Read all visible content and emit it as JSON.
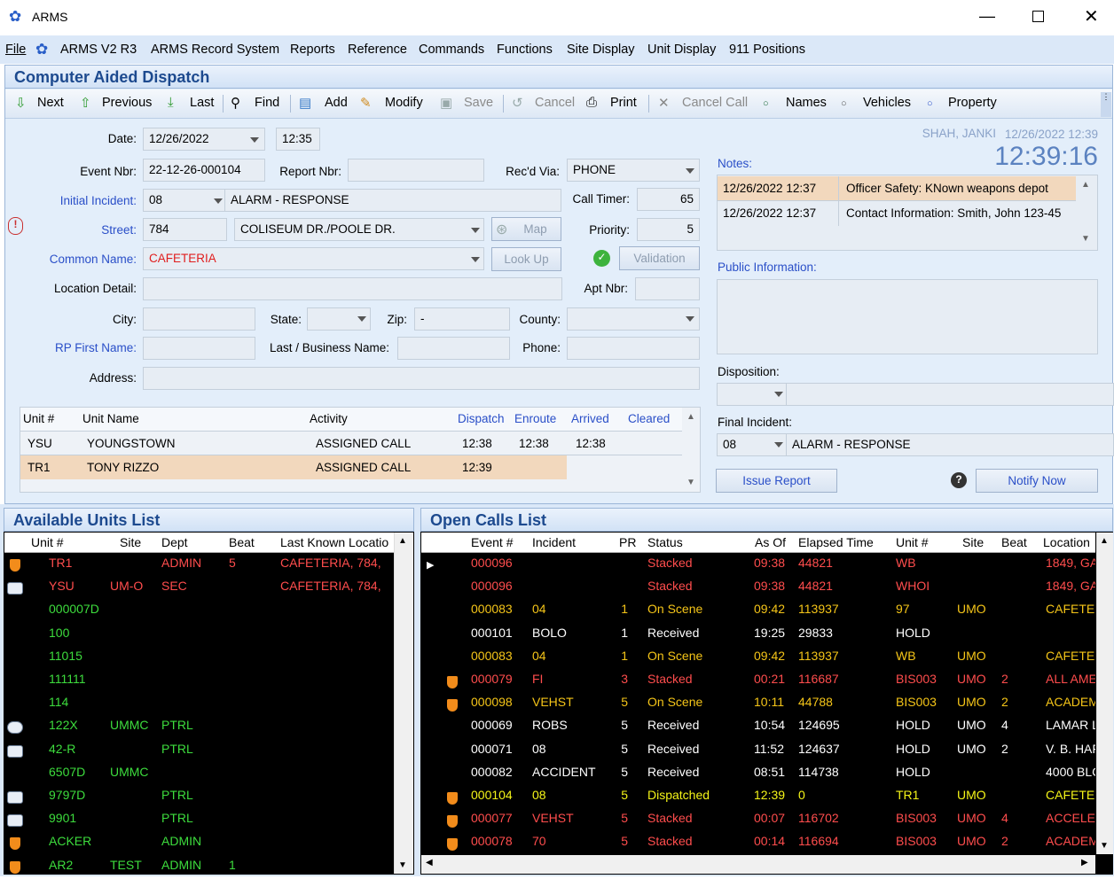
{
  "window": {
    "title": "ARMS"
  },
  "menu": [
    "File",
    "ARMS V2 R3",
    "ARMS Record System",
    "Reports",
    "Reference",
    "Commands",
    "Functions",
    "Site Display",
    "Unit Display",
    "911 Positions"
  ],
  "cad": {
    "title": "Computer Aided Dispatch",
    "toolbar": {
      "next": "Next",
      "previous": "Previous",
      "last": "Last",
      "find": "Find",
      "add": "Add",
      "modify": "Modify",
      "save": "Save",
      "cancel": "Cancel",
      "print": "Print",
      "cancel_call": "Cancel Call",
      "names": "Names",
      "vehicles": "Vehicles",
      "property": "Property"
    },
    "labels": {
      "date": "Date:",
      "event_nbr": "Event Nbr:",
      "report_nbr": "Report Nbr:",
      "recd_via": "Rec'd Via:",
      "initial_incident": "Initial Incident:",
      "call_timer": "Call Timer:",
      "street": "Street:",
      "priority": "Priority:",
      "common_name": "Common Name:",
      "location_detail": "Location Detail:",
      "apt_nbr": "Apt Nbr:",
      "city": "City:",
      "state": "State:",
      "zip": "Zip:",
      "county": "County:",
      "rp_first_name": "RP First Name:",
      "last_business_name": "Last / Business Name:",
      "phone": "Phone:",
      "address": "Address:"
    },
    "values": {
      "date": "12/26/2022",
      "time": "12:35",
      "event_nbr": "22-12-26-000104",
      "recd_via": "PHONE",
      "incident_code": "08",
      "incident_desc": "ALARM - RESPONSE",
      "call_timer": "65",
      "street_number": "784",
      "street_name": "COLISEUM DR./POOLE DR.",
      "priority": "5",
      "common_name": "CAFETERIA",
      "zip": "-"
    },
    "buttons": {
      "map": "Map",
      "look_up": "Look Up",
      "validation": "Validation",
      "issue_report": "Issue Report",
      "notify_now": "Notify Now"
    },
    "user": {
      "name": "SHAH, JANKI",
      "timestamp": "12/26/2022 12:39",
      "clock": "12:39:16"
    },
    "notes": {
      "label": "Notes:",
      "rows": [
        [
          "12/26/2022 12:37",
          "Officer Safety: KNown weapons depot"
        ],
        [
          "12/26/2022 12:37",
          "Contact Information: Smith, John 123-45"
        ]
      ]
    },
    "public_info_label": "Public Information:",
    "disposition_label": "Disposition:",
    "final_incident": {
      "label": "Final Incident:",
      "code": "08",
      "desc": "ALARM - RESPONSE"
    },
    "units": {
      "headers": [
        "Unit #",
        "Unit Name",
        "Activity",
        "Dispatch",
        "Enroute",
        "Arrived",
        "Cleared"
      ],
      "rows": [
        [
          "YSU",
          "YOUNGSTOWN",
          "ASSIGNED CALL",
          "12:38",
          "12:38",
          "12:38",
          ""
        ],
        [
          "TR1",
          "TONY RIZZO",
          "ASSIGNED CALL",
          "12:39",
          "",
          "",
          ""
        ]
      ]
    }
  },
  "available": {
    "title": "Available Units List",
    "headers": [
      "Unit #",
      "Site",
      "Dept",
      "Beat",
      "Last Known Locatio"
    ],
    "rows": [
      {
        "icon": "shield",
        "c": [
          "TR1",
          "",
          "ADMIN",
          "5",
          "CAFETERIA, 784,"
        ],
        "color": "#ff4d4d"
      },
      {
        "icon": "car",
        "c": [
          "YSU",
          "UM-O",
          "SEC",
          "",
          "CAFETERIA, 784,"
        ],
        "color": "#ff4d4d"
      },
      {
        "icon": "",
        "c": [
          "000007D",
          "",
          "",
          "",
          ""
        ],
        "color": "#3ddc3d"
      },
      {
        "icon": "",
        "c": [
          "100",
          "",
          "",
          "",
          ""
        ],
        "color": "#3ddc3d"
      },
      {
        "icon": "",
        "c": [
          "11015",
          "",
          "",
          "",
          ""
        ],
        "color": "#3ddc3d"
      },
      {
        "icon": "",
        "c": [
          "111111",
          "",
          "",
          "",
          ""
        ],
        "color": "#3ddc3d"
      },
      {
        "icon": "",
        "c": [
          "114",
          "",
          "",
          "",
          ""
        ],
        "color": "#3ddc3d"
      },
      {
        "icon": "bike",
        "c": [
          "122X",
          "UMMC",
          "PTRL",
          "",
          ""
        ],
        "color": "#3ddc3d"
      },
      {
        "icon": "car",
        "c": [
          "42-R",
          "",
          "PTRL",
          "",
          ""
        ],
        "color": "#3ddc3d"
      },
      {
        "icon": "",
        "c": [
          "6507D",
          "UMMC",
          "",
          "",
          ""
        ],
        "color": "#3ddc3d"
      },
      {
        "icon": "car",
        "c": [
          "9797D",
          "",
          "PTRL",
          "",
          ""
        ],
        "color": "#3ddc3d"
      },
      {
        "icon": "car",
        "c": [
          "9901",
          "",
          "PTRL",
          "",
          ""
        ],
        "color": "#3ddc3d"
      },
      {
        "icon": "shield",
        "c": [
          "ACKER",
          "",
          "ADMIN",
          "",
          ""
        ],
        "color": "#3ddc3d"
      },
      {
        "icon": "shield",
        "c": [
          "AR2",
          "TEST",
          "ADMIN",
          "1",
          ""
        ],
        "color": "#3ddc3d"
      }
    ]
  },
  "open_calls": {
    "title": "Open Calls List",
    "headers": [
      "Event #",
      "Incident",
      "PR",
      "Status",
      "As Of",
      "Elapsed Time",
      "Unit #",
      "Site",
      "Beat",
      "Location"
    ],
    "rows": [
      {
        "icon": "",
        "c": [
          "000096",
          "",
          "",
          "Stacked",
          "09:38",
          "44821",
          "WB",
          "",
          "",
          "1849, GA"
        ],
        "color": "#ff4d4d"
      },
      {
        "icon": "",
        "c": [
          "000096",
          "",
          "",
          "Stacked",
          "09:38",
          "44821",
          "WHOI",
          "",
          "",
          "1849, GA"
        ],
        "color": "#ff4d4d"
      },
      {
        "icon": "",
        "c": [
          "000083",
          "04",
          "1",
          "On Scene",
          "09:42",
          "113937",
          "97",
          "UMO",
          "",
          "CAFETE"
        ],
        "color": "#f5c518"
      },
      {
        "icon": "",
        "c": [
          "000101",
          "BOLO",
          "1",
          "Received",
          "19:25",
          "29833",
          "HOLD",
          "",
          "",
          ""
        ],
        "color": "#ffffff"
      },
      {
        "icon": "",
        "c": [
          "000083",
          "04",
          "1",
          "On Scene",
          "09:42",
          "113937",
          "WB",
          "UMO",
          "",
          "CAFETE"
        ],
        "color": "#f5c518"
      },
      {
        "icon": "shield",
        "c": [
          "000079",
          "FI",
          "3",
          "Stacked",
          "00:21",
          "116687",
          "BIS003",
          "UMO",
          "2",
          "ALL AME"
        ],
        "color": "#ff4d4d"
      },
      {
        "icon": "shield",
        "c": [
          "000098",
          "VEHST",
          "5",
          "On Scene",
          "10:11",
          "44788",
          "BIS003",
          "UMO",
          "2",
          "ACADEM"
        ],
        "color": "#f5c518"
      },
      {
        "icon": "",
        "c": [
          "000069",
          "ROBS",
          "5",
          "Received",
          "10:54",
          "124695",
          "HOLD",
          "UMO",
          "4",
          "LAMAR L"
        ],
        "color": "#ffffff"
      },
      {
        "icon": "",
        "c": [
          "000071",
          "08",
          "5",
          "Received",
          "11:52",
          "124637",
          "HOLD",
          "UMO",
          "2",
          "V. B. HAF"
        ],
        "color": "#ffffff"
      },
      {
        "icon": "",
        "c": [
          "000082",
          "ACCIDENT",
          "5",
          "Received",
          "08:51",
          "114738",
          "HOLD",
          "",
          "",
          "4000 BLC"
        ],
        "color": "#ffffff"
      },
      {
        "icon": "shield",
        "c": [
          "000104",
          "08",
          "5",
          "Dispatched",
          "12:39",
          "0",
          "TR1",
          "UMO",
          "",
          "CAFETE"
        ],
        "color": "#f5f518"
      },
      {
        "icon": "shield",
        "c": [
          "000077",
          "VEHST",
          "5",
          "Stacked",
          "00:07",
          "116702",
          "BIS003",
          "UMO",
          "4",
          "ACCELEI"
        ],
        "color": "#ff4d4d"
      },
      {
        "icon": "shield",
        "c": [
          "000078",
          "70",
          "5",
          "Stacked",
          "00:14",
          "116694",
          "BIS003",
          "UMO",
          "2",
          "ACADEM"
        ],
        "color": "#ff4d4d"
      }
    ]
  }
}
